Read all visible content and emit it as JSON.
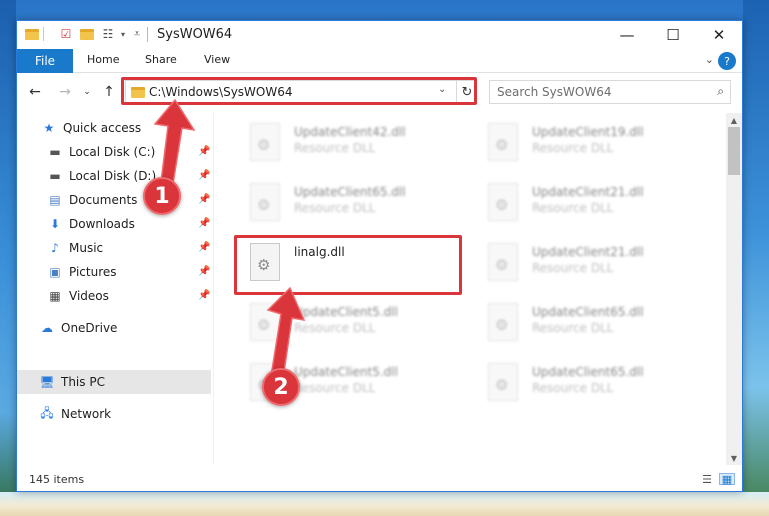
{
  "window": {
    "title": "SysWOW64",
    "controls": {
      "minimize": "—",
      "maximize": "☐",
      "close": "✕"
    }
  },
  "ribbon": {
    "file": "File",
    "tabs": [
      "Home",
      "Share",
      "View"
    ],
    "expand": "⌄",
    "help": "?"
  },
  "address": {
    "path": "C:\\Windows\\SysWOW64",
    "dropdown": "⌄",
    "refresh": "↻"
  },
  "search": {
    "placeholder": "Search SysWOW64"
  },
  "nav": {
    "back": "←",
    "forward": "→",
    "recent": "⌄",
    "up": "↑"
  },
  "sidebar": {
    "quick_access": "Quick access",
    "items": [
      {
        "label": "Local Disk (C:)",
        "icon": "drive-icon"
      },
      {
        "label": "Local Disk (D:)",
        "icon": "drive-icon"
      },
      {
        "label": "Documents",
        "icon": "documents-icon"
      },
      {
        "label": "Downloads",
        "icon": "downloads-icon"
      },
      {
        "label": "Music",
        "icon": "music-icon"
      },
      {
        "label": "Pictures",
        "icon": "pictures-icon"
      },
      {
        "label": "Videos",
        "icon": "videos-icon"
      }
    ],
    "onedrive": "OneDrive",
    "this_pc": "This PC",
    "network": "Network"
  },
  "files": [
    {
      "name": "UpdateClient42.dll",
      "type": "Resource DLL",
      "blurred": true
    },
    {
      "name": "UpdateClient19.dll",
      "type": "Resource DLL",
      "blurred": true
    },
    {
      "name": "UpdateClient65.dll",
      "type": "Resource DLL",
      "blurred": true
    },
    {
      "name": "UpdateClient21.dll",
      "type": "Resource DLL",
      "blurred": true
    },
    {
      "name": "linalg.dll",
      "type": "",
      "blurred": false
    },
    {
      "name": "UpdateClient21.dll",
      "type": "Resource DLL",
      "blurred": true
    },
    {
      "name": "UpdateClient5.dll",
      "type": "Resource DLL",
      "blurred": true
    },
    {
      "name": "UpdateClient65.dll",
      "type": "Resource DLL",
      "blurred": true
    },
    {
      "name": "UpdateClient5.dll",
      "type": "Resource DLL",
      "blurred": true
    },
    {
      "name": "UpdateClient65.dll",
      "type": "Resource DLL",
      "blurred": true
    }
  ],
  "status": {
    "count": "145 items"
  },
  "annotations": {
    "step1": "1",
    "step2": "2",
    "color": "#d9353b"
  }
}
